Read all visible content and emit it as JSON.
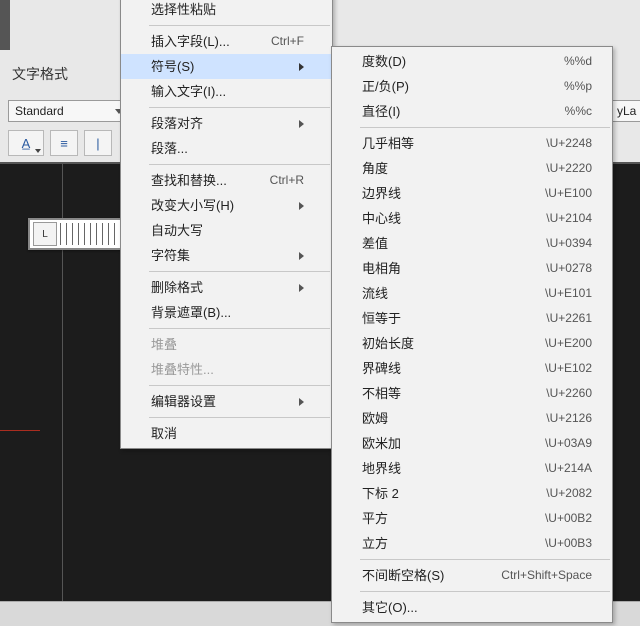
{
  "panel_label": "文字格式",
  "combo_standard": "Standard",
  "combo_right": "yLa",
  "ruler_tab": "L",
  "toolbar_icons": [
    "A̲",
    "≡",
    "|"
  ],
  "menu1": {
    "items": [
      {
        "label": "选择性粘贴",
        "shortcut": "",
        "sub": false,
        "disabled": false,
        "sep_after": true
      },
      {
        "label": "插入字段(L)...",
        "shortcut": "Ctrl+F",
        "sub": false,
        "disabled": false,
        "sep_after": false
      },
      {
        "label": "符号(S)",
        "shortcut": "",
        "sub": true,
        "disabled": false,
        "hover": true,
        "sep_after": false
      },
      {
        "label": "输入文字(I)...",
        "shortcut": "",
        "sub": false,
        "disabled": false,
        "sep_after": true
      },
      {
        "label": "段落对齐",
        "shortcut": "",
        "sub": true,
        "disabled": false,
        "sep_after": false
      },
      {
        "label": "段落...",
        "shortcut": "",
        "sub": false,
        "disabled": false,
        "sep_after": true
      },
      {
        "label": "查找和替换...",
        "shortcut": "Ctrl+R",
        "sub": false,
        "disabled": false,
        "sep_after": false
      },
      {
        "label": "改变大小写(H)",
        "shortcut": "",
        "sub": true,
        "disabled": false,
        "sep_after": false
      },
      {
        "label": "自动大写",
        "shortcut": "",
        "sub": false,
        "disabled": false,
        "sep_after": false
      },
      {
        "label": "字符集",
        "shortcut": "",
        "sub": true,
        "disabled": false,
        "sep_after": true
      },
      {
        "label": "删除格式",
        "shortcut": "",
        "sub": true,
        "disabled": false,
        "sep_after": false
      },
      {
        "label": "背景遮罩(B)...",
        "shortcut": "",
        "sub": false,
        "disabled": false,
        "sep_after": true
      },
      {
        "label": "堆叠",
        "shortcut": "",
        "sub": false,
        "disabled": true,
        "sep_after": false
      },
      {
        "label": "堆叠特性...",
        "shortcut": "",
        "sub": false,
        "disabled": true,
        "sep_after": true
      },
      {
        "label": "编辑器设置",
        "shortcut": "",
        "sub": true,
        "disabled": false,
        "sep_after": true
      },
      {
        "label": "取消",
        "shortcut": "",
        "sub": false,
        "disabled": false,
        "sep_after": false
      }
    ]
  },
  "menu2": {
    "items": [
      {
        "label": "度数(D)",
        "shortcut": "%%d",
        "sep_after": false
      },
      {
        "label": "正/负(P)",
        "shortcut": "%%p",
        "sep_after": false
      },
      {
        "label": "直径(I)",
        "shortcut": "%%c",
        "sep_after": true
      },
      {
        "label": "几乎相等",
        "shortcut": "\\U+2248",
        "sep_after": false
      },
      {
        "label": "角度",
        "shortcut": "\\U+2220",
        "sep_after": false
      },
      {
        "label": "边界线",
        "shortcut": "\\U+E100",
        "sep_after": false
      },
      {
        "label": "中心线",
        "shortcut": "\\U+2104",
        "sep_after": false
      },
      {
        "label": "差值",
        "shortcut": "\\U+0394",
        "sep_after": false
      },
      {
        "label": "电相角",
        "shortcut": "\\U+0278",
        "sep_after": false
      },
      {
        "label": "流线",
        "shortcut": "\\U+E101",
        "sep_after": false
      },
      {
        "label": "恒等于",
        "shortcut": "\\U+2261",
        "sep_after": false
      },
      {
        "label": "初始长度",
        "shortcut": "\\U+E200",
        "sep_after": false
      },
      {
        "label": "界碑线",
        "shortcut": "\\U+E102",
        "sep_after": false
      },
      {
        "label": "不相等",
        "shortcut": "\\U+2260",
        "sep_after": false
      },
      {
        "label": "欧姆",
        "shortcut": "\\U+2126",
        "sep_after": false
      },
      {
        "label": "欧米加",
        "shortcut": "\\U+03A9",
        "sep_after": false
      },
      {
        "label": "地界线",
        "shortcut": "\\U+214A",
        "sep_after": false
      },
      {
        "label": "下标 2",
        "shortcut": "\\U+2082",
        "sep_after": false
      },
      {
        "label": "平方",
        "shortcut": "\\U+00B2",
        "sep_after": false
      },
      {
        "label": "立方",
        "shortcut": "\\U+00B3",
        "sep_after": true
      },
      {
        "label": "不间断空格(S)",
        "shortcut": "Ctrl+Shift+Space",
        "sep_after": true
      },
      {
        "label": "其它(O)...",
        "shortcut": "",
        "sep_after": false
      }
    ]
  }
}
